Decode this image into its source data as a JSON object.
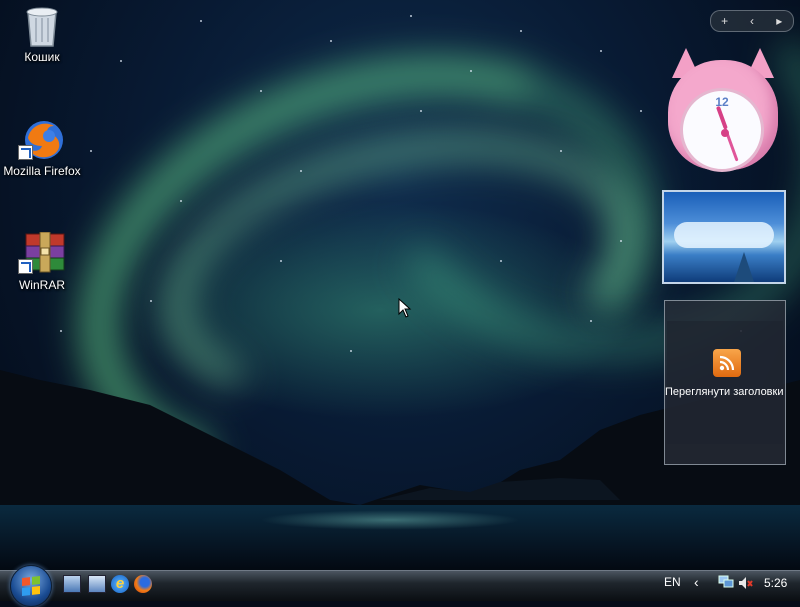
{
  "desktop": {
    "icons": [
      {
        "label": "Кошик"
      },
      {
        "label": "Mozilla Firefox"
      },
      {
        "label": "WinRAR"
      }
    ]
  },
  "sidebar": {
    "controls": {
      "add": "+",
      "prev": "‹",
      "next": "▸"
    },
    "clock": {
      "twelve": "12"
    },
    "feed": {
      "label": "Переглянути заголовки"
    }
  },
  "taskbar": {
    "language": "EN",
    "tray_arrow": "‹",
    "time": "5:26",
    "ie_glyph": "e"
  },
  "colors": {
    "taskbar": "#1f262d",
    "start_orb": "#1a4c93",
    "aurora": "#6ee696",
    "rss": "#f08a2c"
  }
}
